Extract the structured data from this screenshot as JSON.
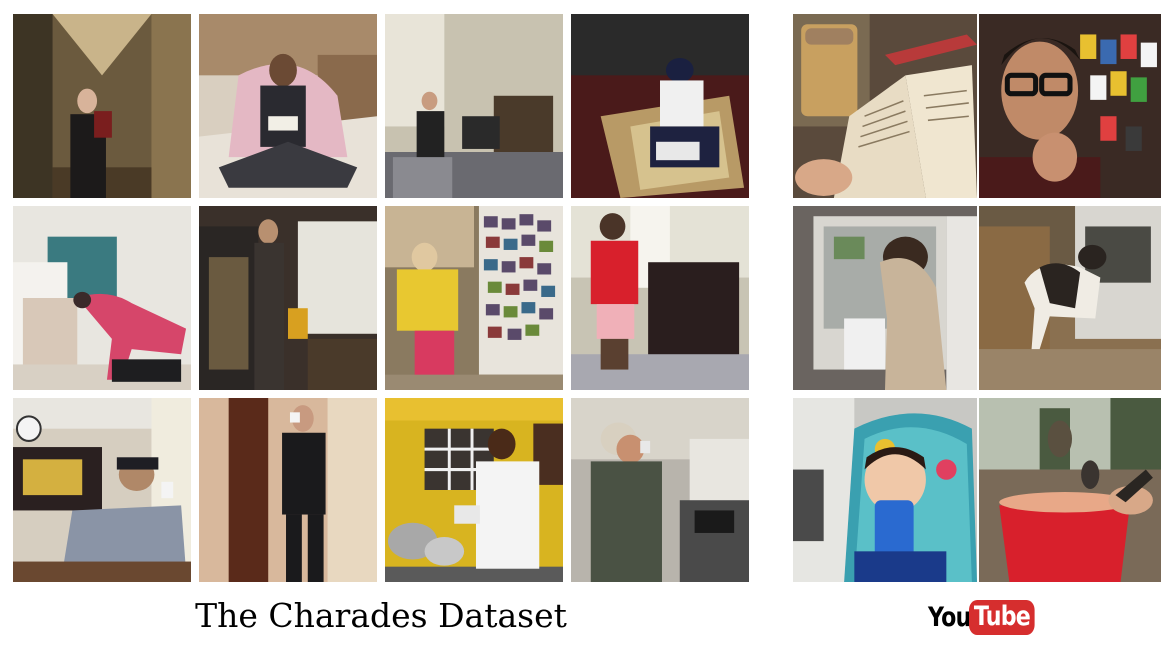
{
  "charades": {
    "caption": "The Charades Dataset",
    "tiles": [
      {
        "name": "charades-reading-hallway",
        "scene": "person reading book in hallway"
      },
      {
        "name": "charades-reading-kitchen-floor",
        "scene": "person with blanket reading on kitchen floor"
      },
      {
        "name": "charades-reading-living-room",
        "scene": "person reading in living room chair"
      },
      {
        "name": "charades-reading-floor-box",
        "scene": "person reading on floor"
      },
      {
        "name": "charades-fridge-bending",
        "scene": "person bending into open refrigerator"
      },
      {
        "name": "charades-fridge-dark-kitchen",
        "scene": "person at refrigerator in dark kitchen"
      },
      {
        "name": "charades-fridge-photos",
        "scene": "person at refrigerator covered in photos"
      },
      {
        "name": "charades-fridge-red-shirt",
        "scene": "person in red shirt at refrigerator"
      },
      {
        "name": "charades-drinking-cap",
        "scene": "person in cap drinking from cup"
      },
      {
        "name": "charades-drinking-doorway",
        "scene": "person drinking in doorway"
      },
      {
        "name": "charades-drinking-kitchen-yellow",
        "scene": "person drinking in yellow kitchen"
      },
      {
        "name": "charades-drinking-kitchen-grey",
        "scene": "person drinking in kitchen"
      }
    ]
  },
  "youtube": {
    "logo": {
      "you": "You",
      "tube": "Tube"
    },
    "colors": {
      "brand_red": "#d62e2e"
    },
    "tiles": [
      {
        "name": "youtube-book-coffee",
        "scene": "open book and coffee mug"
      },
      {
        "name": "youtube-man-glasses",
        "scene": "man with glasses in front of bookshelf"
      },
      {
        "name": "youtube-dog-fridge",
        "scene": "dog reaching into refrigerator"
      },
      {
        "name": "youtube-dog-kitchen",
        "scene": "dog in kitchen"
      },
      {
        "name": "youtube-toddler-cup",
        "scene": "toddler drinking from blue cup"
      },
      {
        "name": "youtube-bird-cup",
        "scene": "bird on hand holding red cup"
      }
    ]
  }
}
